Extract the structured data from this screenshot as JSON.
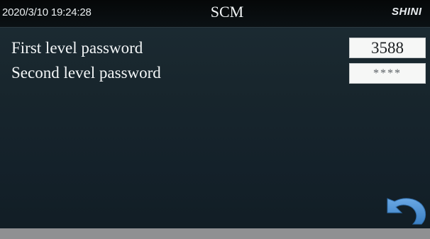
{
  "header": {
    "datetime": "2020/3/10 19:24:28",
    "title": "SCM",
    "brand": "SHINI"
  },
  "passwords": {
    "first_level_label": "First level password",
    "first_level_value": "3588",
    "second_level_label": "Second level password",
    "second_level_value": "****"
  },
  "icons": {
    "back": "back-arrow-icon"
  },
  "colors": {
    "background": "#18262d",
    "title_bar": "#07090a",
    "text": "#f3f6f7",
    "field_background": "#f6f7f6",
    "back_icon": "#4a8fd1"
  }
}
